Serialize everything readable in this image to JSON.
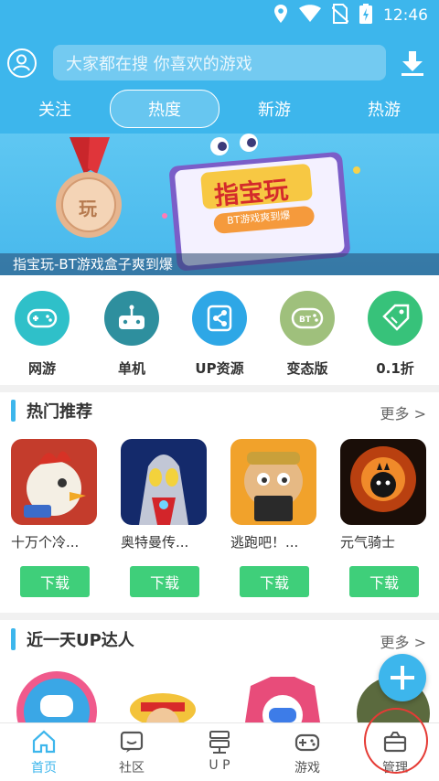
{
  "status": {
    "time": "12:46"
  },
  "search": {
    "placeholder": "大家都在搜 你喜欢的游戏"
  },
  "tabs": [
    {
      "label": "关注"
    },
    {
      "label": "热度",
      "active": true
    },
    {
      "label": "新游"
    },
    {
      "label": "热游"
    }
  ],
  "banner": {
    "caption": "指宝玩-BT游戏盒子爽到爆",
    "art_title": "指宝玩",
    "art_subtitle": "BT游戏爽到爆",
    "medal_text": "玩"
  },
  "categories": [
    {
      "label": "网游",
      "icon": "gamepad-icon",
      "color": "#2fc0c9"
    },
    {
      "label": "单机",
      "icon": "joystick-icon",
      "color": "#2e8f9e"
    },
    {
      "label": "UP资源",
      "icon": "share-icon",
      "color": "#2ea7e6"
    },
    {
      "label": "变态版",
      "icon": "bt-gamepad-icon",
      "color": "#9fc07c"
    },
    {
      "label": "0.1折",
      "icon": "discount-tag-icon",
      "color": "#37c27a"
    }
  ],
  "hot": {
    "title": "热门推荐",
    "more": "更多 >",
    "download_label": "下载",
    "games": [
      {
        "name": "十万个冷...",
        "thumb": "chicken-hero-art"
      },
      {
        "name": "奥特曼传...",
        "thumb": "ultraman-art"
      },
      {
        "name": "逃跑吧！...",
        "thumb": "escape-monkey-art"
      },
      {
        "name": "元气骑士",
        "thumb": "soul-knight-art"
      }
    ]
  },
  "up": {
    "title": "近一天UP达人",
    "more": "更多 >"
  },
  "nav": [
    {
      "label": "首页",
      "icon": "home-icon",
      "active": true
    },
    {
      "label": "社区",
      "icon": "community-icon"
    },
    {
      "label": "U P",
      "icon": "up-server-icon"
    },
    {
      "label": "游戏",
      "icon": "gamepad-nav-icon"
    },
    {
      "label": "管理",
      "icon": "manage-box-icon"
    }
  ],
  "colors": {
    "primary": "#3db6ec",
    "download": "#3fcf7a",
    "highlight": "#e53b35"
  }
}
